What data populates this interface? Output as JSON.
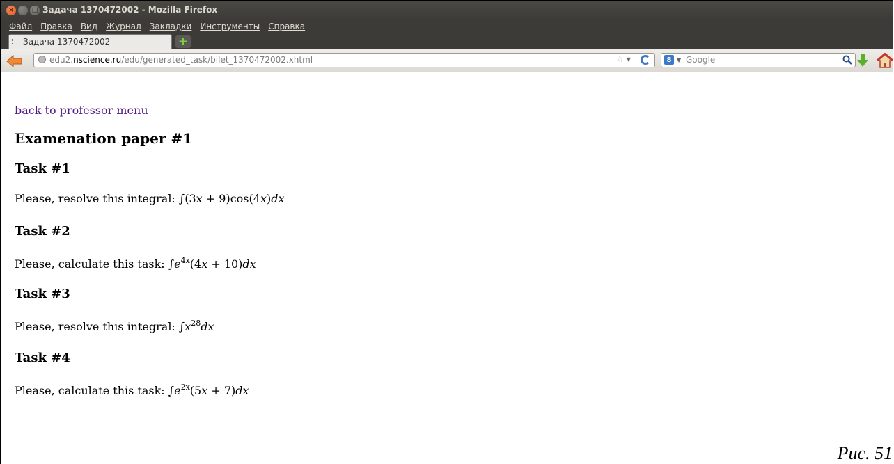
{
  "window": {
    "title": "Задача 1370472002 - Mozilla Firefox",
    "buttons": [
      "close",
      "minimize",
      "maximize"
    ]
  },
  "menubar": {
    "items": [
      "Файл",
      "Правка",
      "Вид",
      "Журнал",
      "Закладки",
      "Инструменты",
      "Справка"
    ]
  },
  "tabs": [
    {
      "label": "Задача 1370472002",
      "active": true
    }
  ],
  "newtab_icon": "plus-icon",
  "navbar": {
    "url_prefix": "edu2.",
    "url_domain": "nscience.ru",
    "url_path": "/edu/generated_task/bilet_1370472002.xhtml",
    "search_placeholder": "Google",
    "search_engine_badge": "8"
  },
  "page": {
    "back_link": "back to professor menu",
    "heading": "Examenation paper #1",
    "tasks": [
      {
        "title": "Task #1",
        "prompt": "Please, resolve this integral: ",
        "formula": {
          "pre": "∫(3",
          "var1": "x",
          "mid": " + 9)cos(4",
          "var2": "x",
          "post": ")"
        }
      },
      {
        "title": "Task #2",
        "prompt": "Please, calculate this task: ",
        "formula": {
          "pre": "∫",
          "base": "e",
          "exp": "4x",
          "body": "(4",
          "var": "x",
          "tail": " + 10)"
        }
      },
      {
        "title": "Task #3",
        "prompt": "Please, resolve this integral: ",
        "formula": {
          "pre": "∫",
          "base": "x",
          "exp": "28"
        }
      },
      {
        "title": "Task #4",
        "prompt": "Please, calculate this task: ",
        "formula": {
          "pre": "∫",
          "base": "e",
          "exp": "2x",
          "body": "(5",
          "var": "x",
          "tail": " + 7)"
        }
      }
    ],
    "differential": "d",
    "differential_var": "x"
  },
  "caption": "Рис. 51",
  "colors": {
    "titlebar": "#3c3b37",
    "link_visited": "#551a8b",
    "close_button": "#e05a1f"
  }
}
